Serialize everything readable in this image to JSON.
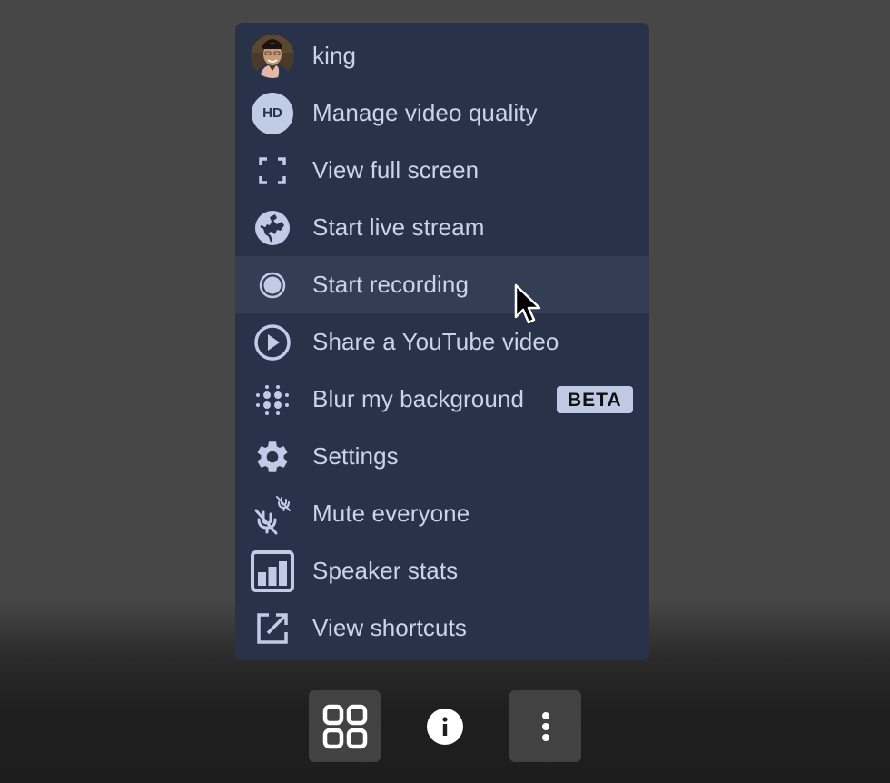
{
  "menu": {
    "items": [
      {
        "id": "profile",
        "label": "king",
        "icon": "user-avatar"
      },
      {
        "id": "video-quality",
        "label": "Manage video quality",
        "icon": "hd-icon",
        "icon_text": "HD"
      },
      {
        "id": "fullscreen",
        "label": "View full screen",
        "icon": "fullscreen-icon"
      },
      {
        "id": "live-stream",
        "label": "Start live stream",
        "icon": "globe-icon"
      },
      {
        "id": "recording",
        "label": "Start recording",
        "icon": "record-icon",
        "hovered": true
      },
      {
        "id": "youtube",
        "label": "Share a YouTube video",
        "icon": "play-circle-icon"
      },
      {
        "id": "blur",
        "label": "Blur my background",
        "icon": "blur-dots-icon",
        "badge": "BETA"
      },
      {
        "id": "settings",
        "label": "Settings",
        "icon": "gear-icon"
      },
      {
        "id": "mute-everyone",
        "label": "Mute everyone",
        "icon": "mic-muted-icon"
      },
      {
        "id": "speaker-stats",
        "label": "Speaker stats",
        "icon": "bar-chart-icon"
      },
      {
        "id": "shortcuts",
        "label": "View shortcuts",
        "icon": "external-link-icon"
      }
    ]
  },
  "toolbar": {
    "buttons": [
      {
        "id": "tile-view",
        "icon": "grid-icon"
      },
      {
        "id": "info",
        "icon": "info-icon"
      },
      {
        "id": "more",
        "icon": "more-vertical-icon"
      }
    ]
  },
  "colors": {
    "menu_bg": "#28334a",
    "menu_hover_bg": "#333e54",
    "menu_text": "#c9d4ea",
    "icon_color": "#c0cce6",
    "page_bg_top": "#474747",
    "page_bg_bottom": "#1d1d1d",
    "toolbar_button_bg": "#424242"
  }
}
